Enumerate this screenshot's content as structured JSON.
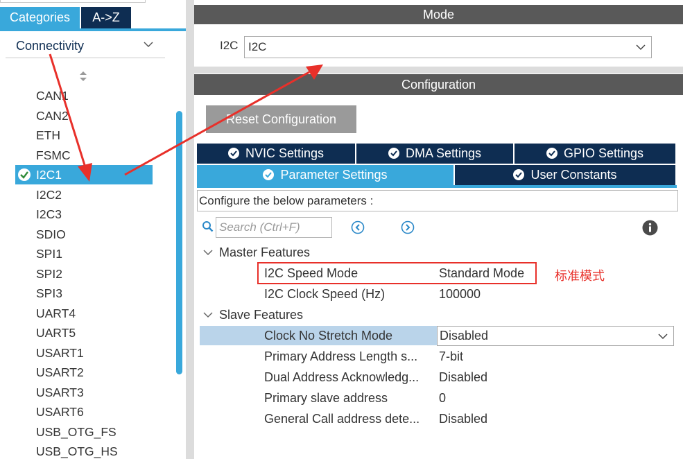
{
  "left": {
    "tabs": [
      {
        "label": "Categories",
        "active": true
      },
      {
        "label": "A->Z",
        "active": false
      }
    ],
    "category": "Connectivity",
    "peripherals": [
      "CAN1",
      "CAN2",
      "ETH",
      "FSMC",
      "I2C1",
      "I2C2",
      "I2C3",
      "SDIO",
      "SPI1",
      "SPI2",
      "SPI3",
      "UART4",
      "UART5",
      "USART1",
      "USART2",
      "USART3",
      "USART6",
      "USB_OTG_FS",
      "USB_OTG_HS"
    ],
    "selected_peripheral": "I2C1"
  },
  "mode": {
    "header": "Mode",
    "label": "I2C",
    "value": "I2C"
  },
  "configuration": {
    "header": "Configuration",
    "reset_label": "Reset Configuration",
    "tabs_row1": [
      "NVIC Settings",
      "DMA Settings",
      "GPIO Settings"
    ],
    "tabs_row2": [
      "Parameter Settings",
      "User Constants"
    ],
    "active_tab": "Parameter Settings",
    "hint": "Configure the below parameters :",
    "search_placeholder": "Search (Ctrl+F)"
  },
  "groups": [
    {
      "name": "Master Features",
      "params": [
        {
          "name": "I2C Speed Mode",
          "value": "Standard Mode"
        },
        {
          "name": "I2C Clock Speed (Hz)",
          "value": "100000"
        }
      ]
    },
    {
      "name": "Slave Features",
      "params": [
        {
          "name": "Clock No Stretch Mode",
          "value": "Disabled"
        },
        {
          "name": "Primary Address Length s...",
          "value": "7-bit"
        },
        {
          "name": "Dual Address Acknowledg...",
          "value": "Disabled"
        },
        {
          "name": "Primary slave address",
          "value": "0"
        },
        {
          "name": "General Call address dete...",
          "value": "Disabled"
        }
      ]
    }
  ],
  "annotation": "标准模式",
  "colors": {
    "accent": "#39a8db",
    "navy": "#0e2d52",
    "header_gray": "#595959",
    "highlight_red": "#e8302a"
  }
}
